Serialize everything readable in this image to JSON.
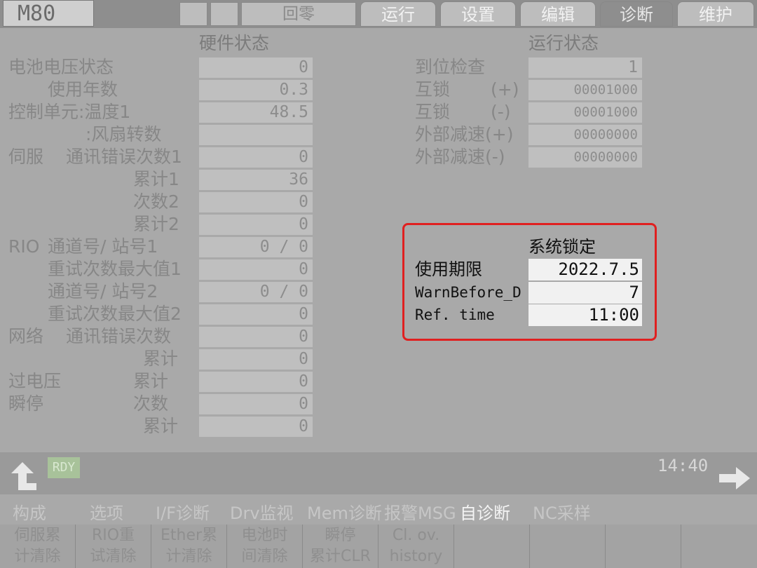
{
  "header": {
    "model": "M80",
    "mode": "回零",
    "tabs": [
      "运行",
      "设置",
      "编辑",
      "诊断",
      "维护"
    ],
    "active_tab": "诊断"
  },
  "hardware": {
    "title": "硬件状态",
    "rows": [
      {
        "label": "电池电压状态",
        "value": "0"
      },
      {
        "label": "使用年数",
        "value": "0.3"
      },
      {
        "label": "控制单元:温度1",
        "value": "48.5"
      },
      {
        "label": ":风扇转数",
        "value": ""
      },
      {
        "label": "伺服",
        "label2": "通讯错误次数1",
        "value": "0"
      },
      {
        "label": "累计1",
        "value": "36"
      },
      {
        "label": "次数2",
        "value": "0"
      },
      {
        "label": "累计2",
        "value": "0"
      },
      {
        "label": "RIO",
        "label2": "通道号/ 站号1",
        "value": "0 / 0"
      },
      {
        "label": "重试次数最大值1",
        "value": "0"
      },
      {
        "label": "通道号/ 站号2",
        "value": "0 / 0"
      },
      {
        "label": "重试次数最大值2",
        "value": "0"
      },
      {
        "label": "网络",
        "label2": "通讯错误次数",
        "value": "0"
      },
      {
        "label": "累计",
        "value": "0"
      },
      {
        "label": "过电压",
        "label2": "累计",
        "value": "0"
      },
      {
        "label": "瞬停",
        "label2": "次数",
        "value": "0"
      },
      {
        "label": "累计",
        "value": "0"
      }
    ]
  },
  "run_status": {
    "title": "运行状态",
    "rows": [
      {
        "label": "到位检查",
        "value": "1"
      },
      {
        "label": "互锁",
        "sign": "(+)",
        "value": "00001000"
      },
      {
        "label": "互锁",
        "sign": "(-)",
        "value": "00001000"
      },
      {
        "label": "外部减速(+)",
        "value": "00000000"
      },
      {
        "label": "外部减速(-)",
        "value": "00000000"
      }
    ]
  },
  "system_lock": {
    "title": "系统锁定",
    "rows": [
      {
        "label": "使用期限",
        "value": "2022.7.5"
      },
      {
        "label": "WarnBefore_D",
        "value": "7"
      },
      {
        "label": "Ref. time",
        "value": "11:00"
      }
    ]
  },
  "status": {
    "rdy": "RDY",
    "time": "14:40"
  },
  "menu": [
    "构成",
    "选项",
    "I/F诊断",
    "Drv监视",
    "Mem诊断",
    "报警MSG",
    "自诊断",
    "NC采样"
  ],
  "active_menu": "自诊断",
  "softkeys": [
    {
      "l1": "伺服累",
      "l2": "计清除"
    },
    {
      "l1": "RIO重",
      "l2": "试清除"
    },
    {
      "l1": "Ether累",
      "l2": "计清除"
    },
    {
      "l1": "电池时",
      "l2": "间清除"
    },
    {
      "l1": "瞬停",
      "l2": "累计CLR"
    },
    {
      "l1": "Cl. ov.",
      "l2": "history"
    }
  ]
}
